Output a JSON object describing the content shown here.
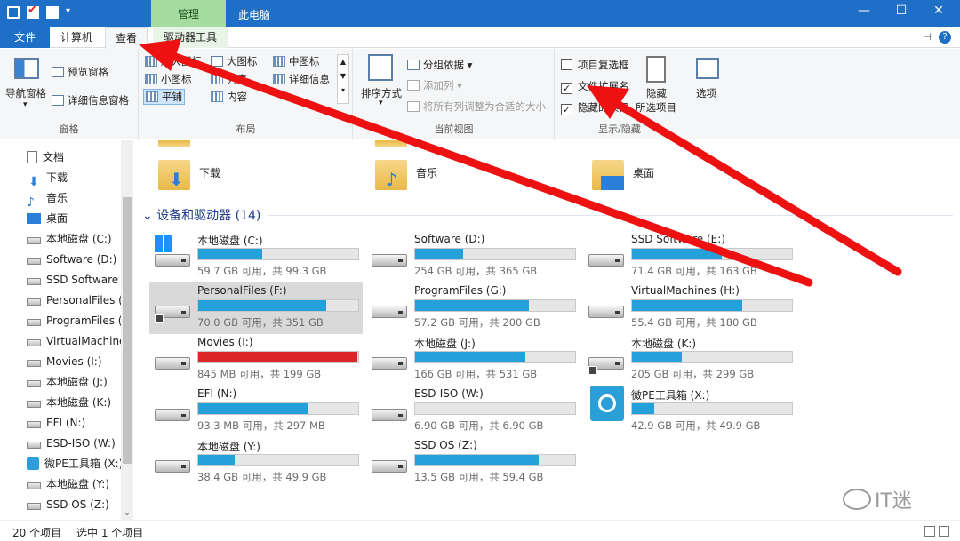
{
  "titlebar": {
    "manage_tab": "管理",
    "window_title": "此电脑",
    "min": "—",
    "max": "☐",
    "close": "✕"
  },
  "tabs": {
    "file": "文件",
    "computer": "计算机",
    "view": "查看",
    "drive_tools": "驱动器工具"
  },
  "ribbon": {
    "panes": {
      "title": "窗格",
      "nav_pane": "导航窗格",
      "preview_pane": "预览窗格",
      "details_pane": "详细信息窗格"
    },
    "layout": {
      "title": "布局",
      "items": [
        "超大图标",
        "大图标",
        "中图标",
        "小图标",
        "列表",
        "详细信息",
        "平铺",
        "内容"
      ],
      "selected": "平铺"
    },
    "current_view": {
      "title": "当前视图",
      "sort_by": "排序方式",
      "group_by": "分组依据",
      "add_columns": "添加列",
      "fit_columns": "将所有列调整为合适的大小"
    },
    "show_hide": {
      "title": "显示/隐藏",
      "item_checkboxes": "项目复选框",
      "item_checkboxes_checked": false,
      "file_extensions": "文件扩展名",
      "file_extensions_checked": true,
      "hidden_items": "隐藏的项目",
      "hidden_items_checked": true,
      "hide_selected_line1": "隐藏",
      "hide_selected_line2": "所选项目",
      "options": "选项"
    }
  },
  "sidebar": {
    "items": [
      {
        "label": "文档",
        "icon": "document-icon"
      },
      {
        "label": "下载",
        "icon": "download-icon"
      },
      {
        "label": "音乐",
        "icon": "music-icon"
      },
      {
        "label": "桌面",
        "icon": "desktop-icon"
      },
      {
        "label": "本地磁盘 (C:)",
        "icon": "drive-icon"
      },
      {
        "label": "Software (D:)",
        "icon": "drive-icon"
      },
      {
        "label": "SSD Software",
        "icon": "drive-icon"
      },
      {
        "label": "PersonalFiles (F",
        "icon": "drive-icon"
      },
      {
        "label": "ProgramFiles (",
        "icon": "drive-icon"
      },
      {
        "label": "VirtualMachine",
        "icon": "drive-icon"
      },
      {
        "label": "Movies (I:)",
        "icon": "drive-icon"
      },
      {
        "label": "本地磁盘 (J:)",
        "icon": "drive-icon"
      },
      {
        "label": "本地磁盘 (K:)",
        "icon": "drive-icon"
      },
      {
        "label": "EFI (N:)",
        "icon": "drive-icon"
      },
      {
        "label": "ESD-ISO (W:)",
        "icon": "drive-icon"
      },
      {
        "label": "微PE工具箱 (X:)",
        "icon": "pe-icon"
      },
      {
        "label": "本地磁盘 (Y:)",
        "icon": "drive-icon"
      },
      {
        "label": "SSD OS (Z:)",
        "icon": "drive-icon"
      }
    ]
  },
  "folders": [
    {
      "name": "下载",
      "icon": "download-folder-icon"
    },
    {
      "name": "音乐",
      "icon": "music-folder-icon"
    },
    {
      "name": "桌面",
      "icon": "desktop-folder-icon"
    }
  ],
  "devices_header": "设备和驱动器 (14)",
  "drives": [
    {
      "name": "本地磁盘 (C:)",
      "info": "59.7 GB 可用，共 99.3 GB",
      "used_fraction": 0.4
    },
    {
      "name": "Software (D:)",
      "info": "254 GB 可用，共 365 GB",
      "used_fraction": 0.3
    },
    {
      "name": "SSD Software (E:)",
      "info": "71.4 GB 可用，共 163 GB",
      "used_fraction": 0.56
    },
    {
      "name": "PersonalFiles (F:)",
      "info": "70.0 GB 可用，共 351 GB",
      "used_fraction": 0.8
    },
    {
      "name": "ProgramFiles (G:)",
      "info": "57.2 GB 可用，共 200 GB",
      "used_fraction": 0.71
    },
    {
      "name": "VirtualMachines (H:)",
      "info": "55.4 GB 可用，共 180 GB",
      "used_fraction": 0.69
    },
    {
      "name": "Movies (I:)",
      "info": "845 MB 可用，共 199 GB",
      "used_fraction": 0.996
    },
    {
      "name": "本地磁盘 (J:)",
      "info": "166 GB 可用，共 531 GB",
      "used_fraction": 0.69
    },
    {
      "name": "本地磁盘 (K:)",
      "info": "205 GB 可用，共 299 GB",
      "used_fraction": 0.31
    },
    {
      "name": "EFI (N:)",
      "info": "93.3 MB 可用，共 297 MB",
      "used_fraction": 0.69
    },
    {
      "name": "ESD-ISO (W:)",
      "info": "6.90 GB 可用，共 6.90 GB",
      "used_fraction": 0.0
    },
    {
      "name": "微PE工具箱 (X:)",
      "info": "42.9 GB 可用，共 49.9 GB",
      "used_fraction": 0.14
    },
    {
      "name": "本地磁盘 (Y:)",
      "info": "38.4 GB 可用，共 49.9 GB",
      "used_fraction": 0.23
    },
    {
      "name": "SSD OS (Z:)",
      "info": "13.5 GB 可用，共 59.4 GB",
      "used_fraction": 0.77
    }
  ],
  "status": {
    "count": "20 个项目",
    "selected": "选中 1 个项目"
  },
  "watermark": "IT迷",
  "colors": {
    "accent": "#1e6fc6",
    "drive_bar": "#26a0da",
    "drive_bar_full": "#da2626",
    "arrow": "#ee1111"
  }
}
